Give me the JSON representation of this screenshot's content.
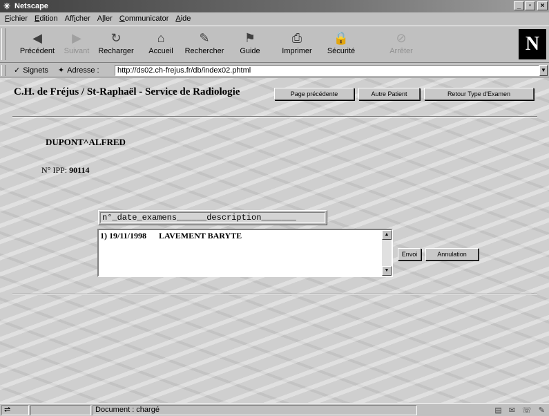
{
  "window": {
    "title": "Netscape",
    "app_icon": "netscape-star-icon",
    "minimize": "_",
    "maximize": "▫",
    "close": "×"
  },
  "menubar": [
    {
      "ul": "F",
      "rest": "ichier"
    },
    {
      "ul": "E",
      "rest": "dition"
    },
    {
      "pre": "Aff",
      "ul": "i",
      "rest": "cher"
    },
    {
      "pre": "A",
      "ul": "l",
      "rest": "ler"
    },
    {
      "ul": "C",
      "rest": "ommunicator"
    },
    {
      "ul": "A",
      "rest": "ide"
    }
  ],
  "toolbar": {
    "back": "Précédent",
    "forward": "Suivant",
    "reload": "Recharger",
    "home": "Accueil",
    "search": "Rechercher",
    "guide": "Guide",
    "print": "Imprimer",
    "security": "Sécurité",
    "stop": "Arrêter",
    "logo": "N"
  },
  "location": {
    "bookmarks_label": "Signets",
    "address_label": "Adresse :",
    "url": "http://ds02.ch-frejus.fr/db/index02.phtml"
  },
  "page": {
    "title": "C.H. de Fréjus / St-Raphaël - Service de Radiologie",
    "btn_prev": "Page précédente",
    "btn_other": "Autre Patient",
    "btn_return": "Retour Type d'Examen",
    "patient_name": "DUPONT^ALFRED",
    "ipp_label": "N° IPP:",
    "ipp_value": "90114",
    "list_header": "n°_date_examens______description_______",
    "exam_rows": [
      "1) 19/11/1998      LAVEMENT BARYTE"
    ],
    "btn_send": "Envoi",
    "btn_cancel": "Annulation"
  },
  "status": {
    "text": "Document : chargé"
  }
}
